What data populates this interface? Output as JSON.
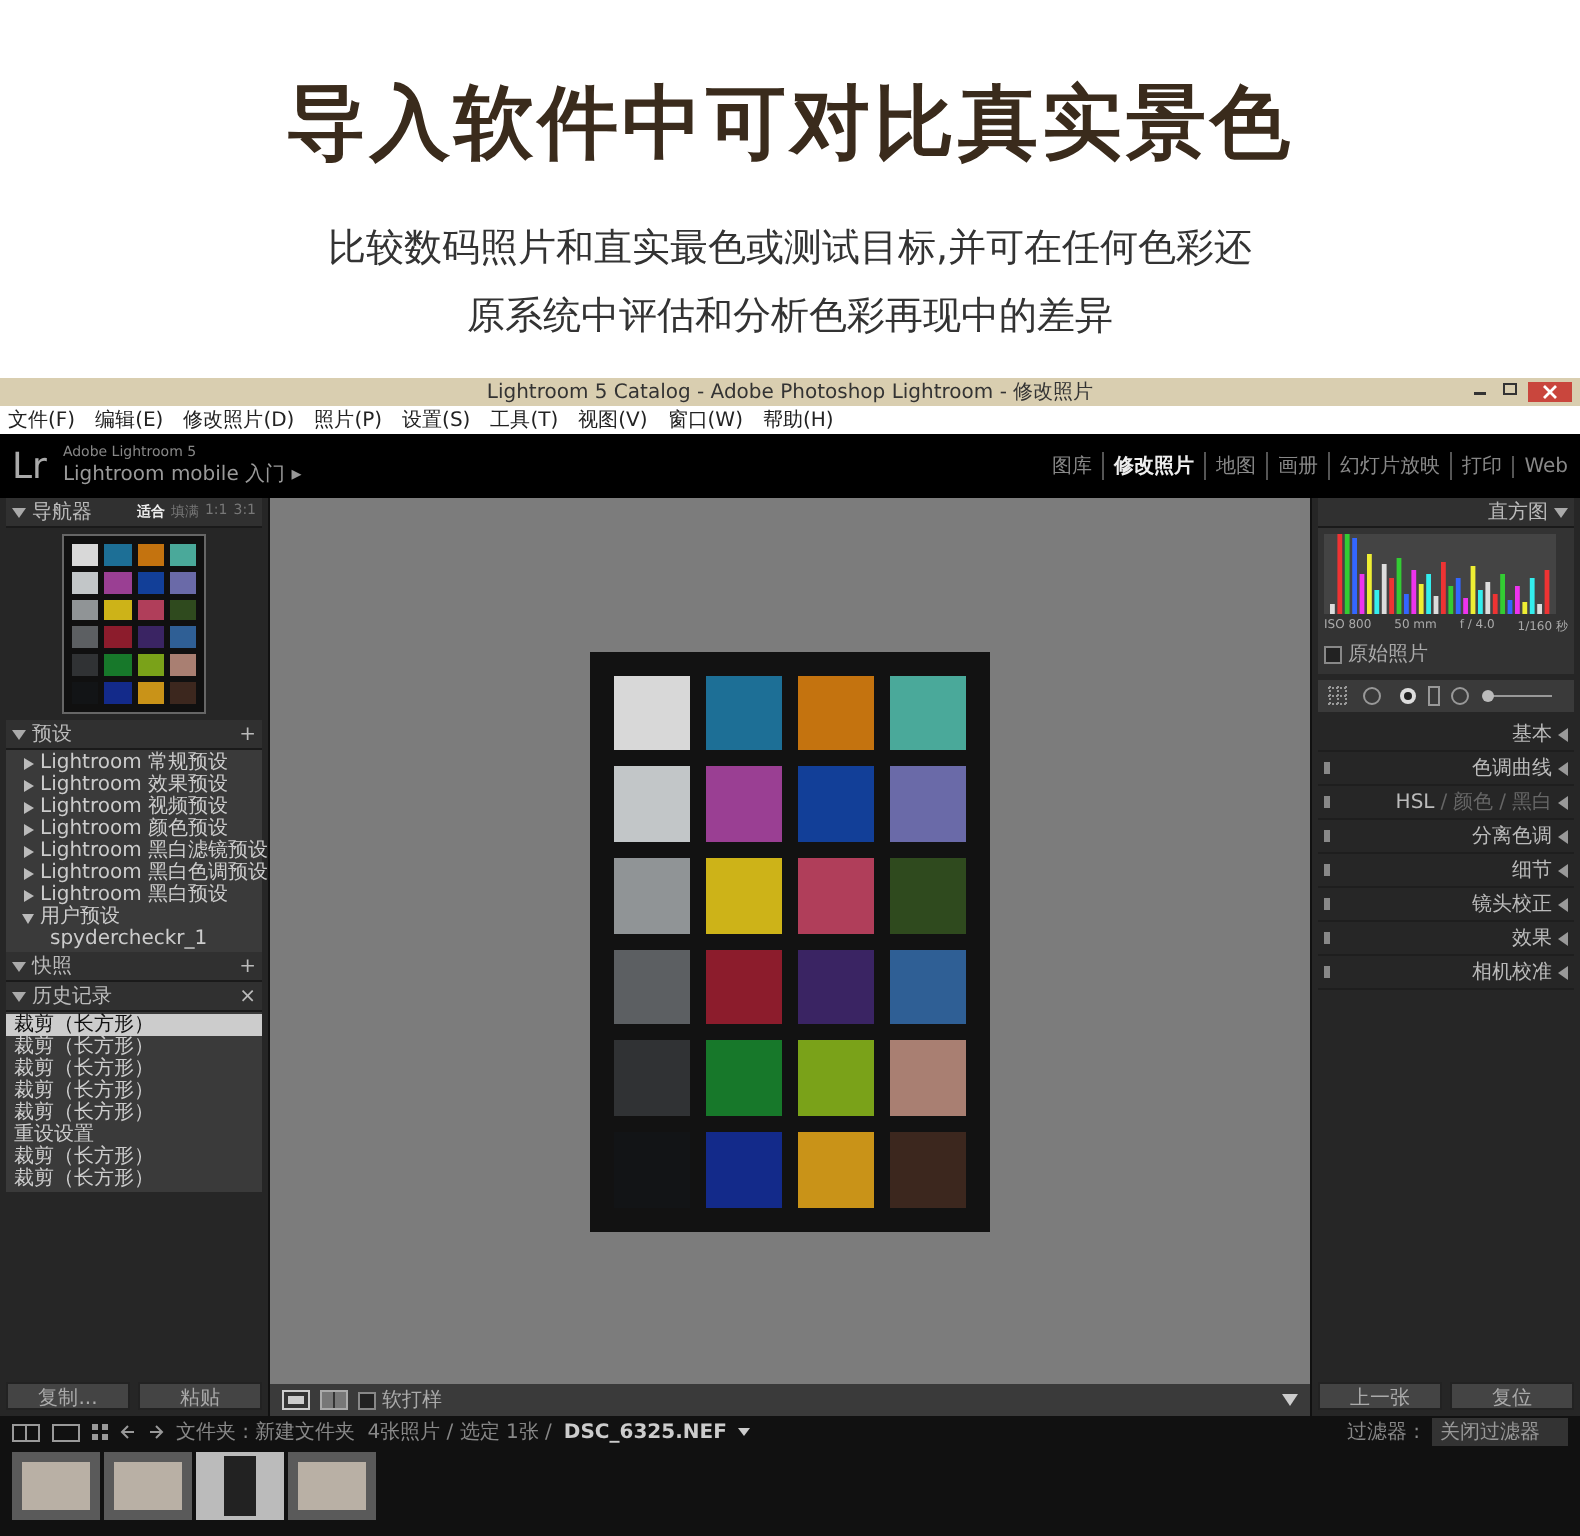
{
  "header": {
    "title": "导入软件中可对比真实景色",
    "subtitle_lines": [
      "比较数码照片和直实最色或测试目标,并可在任何色彩还",
      "原系统中评估和分析色彩再现中的差异"
    ]
  },
  "window": {
    "title": "Lightroom 5 Catalog - Adobe Photoshop Lightroom - 修改照片"
  },
  "menu": [
    "文件(F)",
    "编辑(E)",
    "修改照片(D)",
    "照片(P)",
    "设置(S)",
    "工具(T)",
    "视图(V)",
    "窗口(W)",
    "帮助(H)"
  ],
  "identity": {
    "logo": "Lr",
    "product": "Adobe Lightroom 5",
    "mobile": "Lightroom mobile 入门",
    "arrow": "▸"
  },
  "modules": [
    {
      "label": "图库",
      "selected": false
    },
    {
      "label": "修改照片",
      "selected": true
    },
    {
      "label": "地图",
      "selected": false
    },
    {
      "label": "画册",
      "selected": false
    },
    {
      "label": "幻灯片放映",
      "selected": false
    },
    {
      "label": "打印",
      "selected": false
    },
    {
      "label": "Web",
      "selected": false
    }
  ],
  "left_panel": {
    "navigator": {
      "title": "导航器",
      "zoom_options": [
        {
          "label": "适合",
          "selected": true
        },
        {
          "label": "填满",
          "selected": false
        },
        {
          "label": "1:1",
          "selected": false
        },
        {
          "label": "3:1",
          "selected": false
        }
      ]
    },
    "presets": {
      "title": "预设",
      "add": "+",
      "items": [
        {
          "label": "Lightroom 常规预设",
          "expanded": false
        },
        {
          "label": "Lightroom 效果预设",
          "expanded": false
        },
        {
          "label": "Lightroom 视频预设",
          "expanded": false
        },
        {
          "label": "Lightroom 颜色预设",
          "expanded": false
        },
        {
          "label": "Lightroom 黑白滤镜预设",
          "expanded": false
        },
        {
          "label": "Lightroom 黑白色调预设",
          "expanded": false
        },
        {
          "label": "Lightroom 黑白预设",
          "expanded": false
        },
        {
          "label": "用户预设",
          "expanded": true,
          "children": [
            {
              "label": "spydercheckr_1"
            }
          ]
        }
      ]
    },
    "snapshots": {
      "title": "快照",
      "add": "+"
    },
    "history": {
      "title": "历史记录",
      "clear": "×",
      "items": [
        {
          "label": "裁剪（长方形）",
          "selected": true
        },
        {
          "label": "裁剪（长方形）",
          "selected": false
        },
        {
          "label": "裁剪（长方形）",
          "selected": false
        },
        {
          "label": "裁剪（长方形）",
          "selected": false
        },
        {
          "label": "裁剪（长方形）",
          "selected": false
        },
        {
          "label": "重设设置",
          "selected": false
        },
        {
          "label": "裁剪（长方形）",
          "selected": false
        },
        {
          "label": "裁剪（长方形）",
          "selected": false
        }
      ]
    },
    "buttons": [
      "复制...",
      "粘贴"
    ]
  },
  "toolbar": {
    "soft_proof": {
      "label": "软打样",
      "checked": false
    }
  },
  "right_panel": {
    "histogram": {
      "title": "直方图",
      "info": [
        "ISO 800",
        "50 mm",
        "f / 4.0",
        "1/160 秒"
      ],
      "original_photo": {
        "label": "原始照片",
        "checked": false
      }
    },
    "sections": [
      {
        "kind": "single",
        "label": "基本",
        "switch": false
      },
      {
        "kind": "single",
        "label": "色调曲线",
        "switch": true
      },
      {
        "kind": "multi",
        "parts": [
          {
            "label": "HSL",
            "selected": true
          },
          {
            "label": "颜色",
            "selected": false
          },
          {
            "label": "黑白",
            "selected": false
          }
        ],
        "separator": "/",
        "switch": true
      },
      {
        "kind": "single",
        "label": "分离色调",
        "switch": true
      },
      {
        "kind": "single",
        "label": "细节",
        "switch": true
      },
      {
        "kind": "single",
        "label": "镜头校正",
        "switch": true
      },
      {
        "kind": "single",
        "label": "效果",
        "switch": true
      },
      {
        "kind": "single",
        "label": "相机校准",
        "switch": true
      }
    ],
    "buttons": [
      "上一张",
      "复位"
    ]
  },
  "filmstrip": {
    "path": "文件夹 : 新建文件夹",
    "count": "4张照片 / 选定 1张 /",
    "file": "DSC_6325.NEF",
    "filter_label": "过滤器 :",
    "filter_value": "关闭过滤器",
    "thumbnails": [
      {
        "selected": false
      },
      {
        "selected": false
      },
      {
        "selected": true
      },
      {
        "selected": false
      }
    ]
  }
}
